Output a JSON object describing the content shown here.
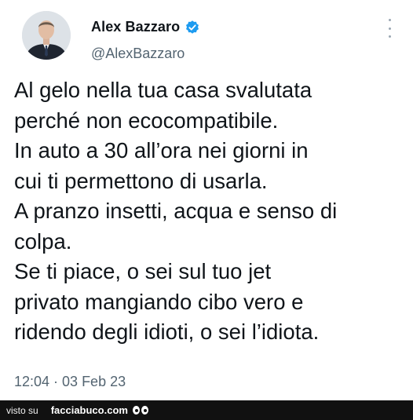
{
  "tweet": {
    "display_name": "Alex Bazzaro",
    "handle": "@AlexBazzaro",
    "verified": true,
    "body_lines": [
      "Al gelo nella tua casa svalutata",
      "perché non ecocompatibile.",
      "In auto a 30 all’ora nei giorni in",
      "cui ti permettono di usarla.",
      "A pranzo insetti, acqua e senso di",
      "colpa.",
      "Se ti piace, o sei sul tuo jet",
      "privato mangiando cibo vero e",
      "ridendo degli idioti, o sei l’idiota."
    ],
    "timestamp": "12:04 · 03 Feb 23"
  },
  "icons": {
    "avatar": "profile-photo",
    "verified": "verified-badge-icon",
    "more": "more-options-icon"
  },
  "colors": {
    "text": "#0f1419",
    "secondary": "#536471",
    "verified": "#1d9bf0",
    "footer_bg": "#111111"
  },
  "footer": {
    "prefix": "visto su",
    "brand": "facciabuco.com"
  }
}
